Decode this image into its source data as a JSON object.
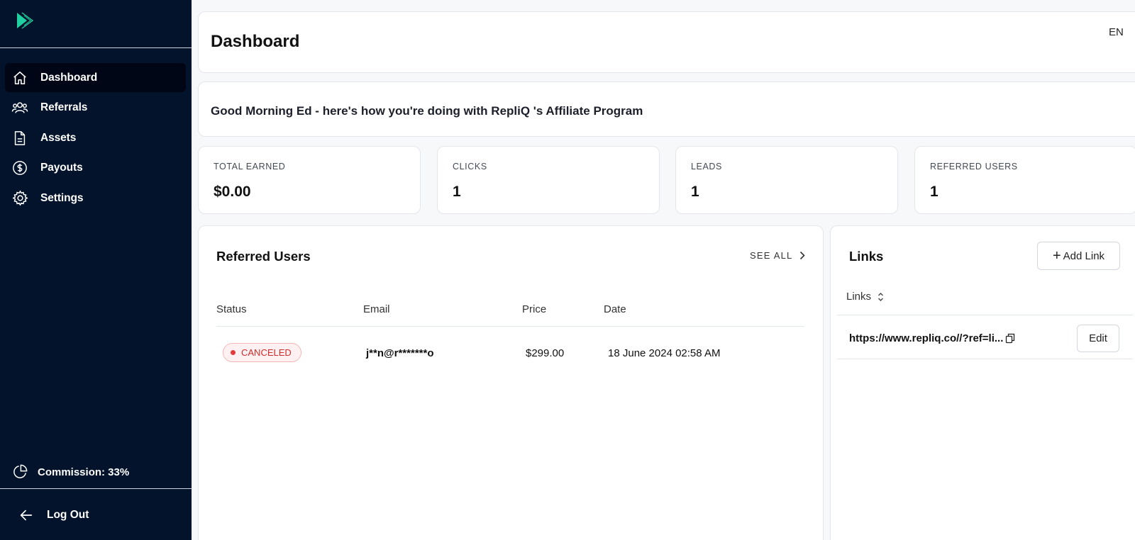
{
  "sidebar": {
    "items": [
      {
        "label": "Dashboard",
        "icon": "home-icon",
        "active": true
      },
      {
        "label": "Referrals",
        "icon": "users-icon"
      },
      {
        "label": "Assets",
        "icon": "document-icon"
      },
      {
        "label": "Payouts",
        "icon": "dollar-icon"
      },
      {
        "label": "Settings",
        "icon": "gear-icon"
      }
    ],
    "commission": "Commission: 33%",
    "logout": "Log Out"
  },
  "header": {
    "title": "Dashboard",
    "language": "EN"
  },
  "greeting": "Good Morning Ed - here's how you're doing with RepliQ 's Affiliate Program",
  "stats": [
    {
      "label": "TOTAL EARNED",
      "value": "$0.00"
    },
    {
      "label": "CLICKS",
      "value": "1"
    },
    {
      "label": "LEADS",
      "value": "1"
    },
    {
      "label": "REFERRED USERS",
      "value": "1"
    }
  ],
  "referred_users": {
    "title": "Referred Users",
    "see_all": "SEE ALL",
    "columns": [
      "Status",
      "Email",
      "Price",
      "Date"
    ],
    "rows": [
      {
        "status": "CANCELED",
        "email": "j**n@r*******o",
        "price": "$299.00",
        "date": "18 June 2024 02:58 AM"
      }
    ]
  },
  "links": {
    "title": "Links",
    "add_label": "Add Link",
    "column": "Links",
    "rows": [
      {
        "url": "https://www.repliq.co//?ref=li...",
        "edit_label": "Edit"
      }
    ]
  },
  "colors": {
    "sidebar_bg": "#03132b",
    "active_bg": "#000615",
    "brand_accent": "#1fd1a0",
    "status_canceled": "#d12d2d"
  }
}
